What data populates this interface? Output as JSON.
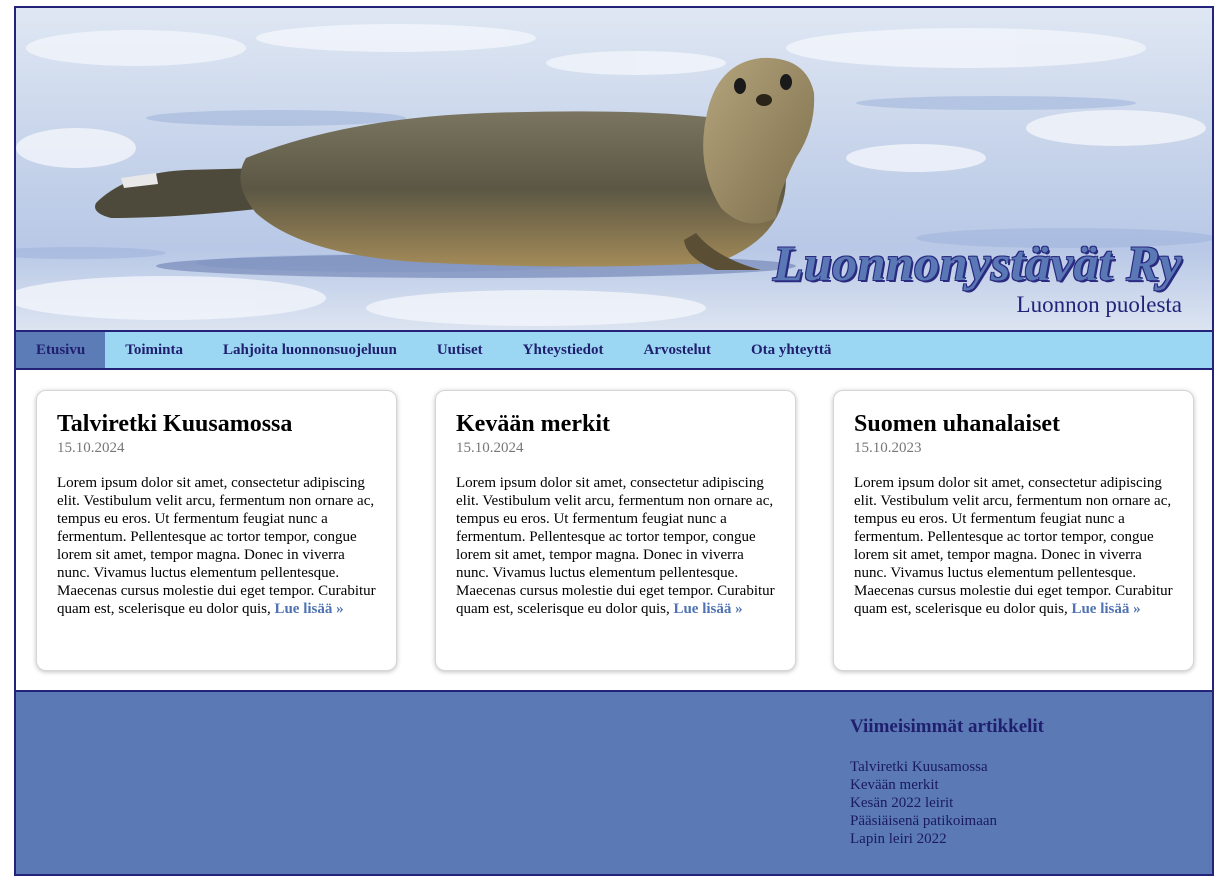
{
  "header": {
    "title": "Luonnonystävät Ry",
    "subtitle": "Luonnon puolesta"
  },
  "nav": {
    "items": [
      {
        "label": "Etusivu",
        "active": true
      },
      {
        "label": "Toiminta"
      },
      {
        "label": "Lahjoita luonnonsuojeluun"
      },
      {
        "label": "Uutiset"
      },
      {
        "label": "Yhteystiedot"
      },
      {
        "label": "Arvostelut"
      },
      {
        "label": "Ota yhteyttä"
      }
    ]
  },
  "articles": [
    {
      "title": "Talviretki Kuusamossa",
      "date": "15.10.2024",
      "text": "Lorem ipsum dolor sit amet, consectetur adipiscing elit. Vestibulum velit arcu, fermentum non ornare ac, tempus eu eros. Ut fermentum feugiat nunc a fermentum. Pellentesque ac tortor tempor, congue lorem sit amet, tempor magna. Donec in viverra nunc. Vivamus luctus elementum pellentesque. Maecenas cursus molestie dui eget tempor. Curabitur quam est, scelerisque eu dolor quis, ",
      "more": "Lue lisää »"
    },
    {
      "title": "Kevään merkit",
      "date": "15.10.2024",
      "text": "Lorem ipsum dolor sit amet, consectetur adipiscing elit. Vestibulum velit arcu, fermentum non ornare ac, tempus eu eros. Ut fermentum feugiat nunc a fermentum. Pellentesque ac tortor tempor, congue lorem sit amet, tempor magna. Donec in viverra nunc. Vivamus luctus elementum pellentesque. Maecenas cursus molestie dui eget tempor. Curabitur quam est, scelerisque eu dolor quis, ",
      "more": "Lue lisää »"
    },
    {
      "title": "Suomen uhanalaiset",
      "date": "15.10.2023",
      "text": "Lorem ipsum dolor sit amet, consectetur adipiscing elit. Vestibulum velit arcu, fermentum non ornare ac, tempus eu eros. Ut fermentum feugiat nunc a fermentum. Pellentesque ac tortor tempor, congue lorem sit amet, tempor magna. Donec in viverra nunc. Vivamus luctus elementum pellentesque. Maecenas cursus molestie dui eget tempor. Curabitur quam est, scelerisque eu dolor quis, ",
      "more": "Lue lisää »"
    }
  ],
  "footer": {
    "heading": "Viimeisimmät artikkelit",
    "links": [
      "Talviretki Kuusamossa",
      "Kevään merkit",
      "Kesän 2022 leirit",
      "Pääsiäisenä patikoimaan",
      "Lapin leiri 2022"
    ]
  },
  "colors": {
    "border": "#23237a",
    "nav_bg": "#9bd6f3",
    "nav_active": "#5b7cb6",
    "footer_bg": "#5b7ab5",
    "link": "#4f73b2"
  }
}
